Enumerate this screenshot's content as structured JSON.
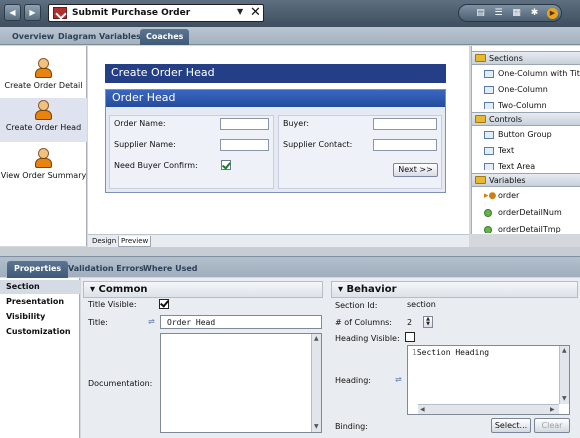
{
  "titlebar": {
    "title": "Submit Purchase Order",
    "back_glyph": "◀",
    "forward_glyph": "▶",
    "dropdown_glyph": "▼",
    "close_glyph": "✕"
  },
  "toolbar_icons": [
    "page-icon",
    "list-icon",
    "grid-icon",
    "debug-bug-icon",
    "run-icon"
  ],
  "main_tabs": [
    "Overview",
    "Diagram",
    "Variables",
    "Coaches"
  ],
  "active_main_tab": "Coaches",
  "coaches": [
    {
      "label": "Create Order Detail"
    },
    {
      "label": "Create Order Head"
    },
    {
      "label": "View Order Summary"
    }
  ],
  "selected_coach": "Create Order Head",
  "canvas": {
    "coach_title": "Create Order Head",
    "section_title": "Order Head",
    "left_fields": [
      {
        "label": "Order Name:"
      },
      {
        "label": "Supplier Name:"
      },
      {
        "label": "Need Buyer Confirm:",
        "checked": true
      }
    ],
    "right_fields": [
      {
        "label": "Buyer:"
      },
      {
        "label": "Supplier Contact:"
      }
    ],
    "next_button": "Next >>"
  },
  "canvas_tabs": [
    "Design",
    "Preview"
  ],
  "active_canvas_tab": "Design",
  "palette": {
    "sections_label": "Sections",
    "sections_items": [
      "One-Column with Title",
      "One-Column",
      "Two-Column"
    ],
    "controls_label": "Controls",
    "controls_items": [
      "Button Group",
      "Text",
      "Text Area"
    ],
    "variables_label": "Variables",
    "variables_items": [
      "order",
      "orderDetailNum",
      "orderDetailTmp"
    ]
  },
  "properties_tabs": [
    "Properties",
    "Validation Errors",
    "Where Used"
  ],
  "active_properties_tab": "Properties",
  "properties_nav": [
    "Section",
    "Presentation",
    "Visibility",
    "Customization"
  ],
  "active_properties_nav": "Section",
  "common": {
    "header": "Common",
    "collapse_glyph": "▾",
    "title_visible_label": "Title Visible:",
    "title_visible": true,
    "title_label": "Title:",
    "title_value": "Order Head",
    "documentation_label": "Documentation:",
    "documentation_value": ""
  },
  "behavior": {
    "header": "Behavior",
    "collapse_glyph": "▾",
    "section_id_label": "Section Id:",
    "section_id_value": "section",
    "columns_label": "# of Columns:",
    "columns_value": "2",
    "heading_visible_label": "Heading Visible:",
    "heading_visible": false,
    "heading_label": "Heading:",
    "heading_line_number": "1",
    "heading_value": "Section Heading",
    "binding_label": "Binding:",
    "select_button": "Select...",
    "clear_button": "Clear"
  }
}
